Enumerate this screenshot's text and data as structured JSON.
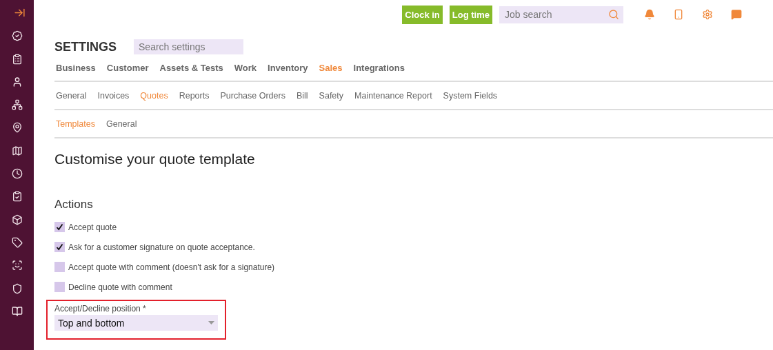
{
  "topbar": {
    "buttons": [
      {
        "label": "Clock in"
      },
      {
        "label": "Log time"
      }
    ],
    "search": {
      "placeholder": "Job search"
    }
  },
  "settings": {
    "title": "SETTINGS",
    "search": {
      "placeholder": "Search settings"
    }
  },
  "main_tabs": [
    {
      "label": "Business",
      "selected": false
    },
    {
      "label": "Customer",
      "selected": false
    },
    {
      "label": "Assets & Tests",
      "selected": false
    },
    {
      "label": "Work",
      "selected": false
    },
    {
      "label": "Inventory",
      "selected": false
    },
    {
      "label": "Sales",
      "selected": true
    },
    {
      "label": "Integrations",
      "selected": false
    }
  ],
  "sub_tabs": [
    {
      "label": "General",
      "selected": false
    },
    {
      "label": "Invoices",
      "selected": false
    },
    {
      "label": "Quotes",
      "selected": true
    },
    {
      "label": "Reports",
      "selected": false
    },
    {
      "label": "Purchase Orders",
      "selected": false
    },
    {
      "label": "Bill",
      "selected": false
    },
    {
      "label": "Safety",
      "selected": false
    },
    {
      "label": "Maintenance Report",
      "selected": false
    },
    {
      "label": "System Fields",
      "selected": false
    }
  ],
  "section_tabs": [
    {
      "label": "Templates",
      "selected": true
    },
    {
      "label": "General",
      "selected": false
    }
  ],
  "page_title": "Customise your quote template",
  "actions": {
    "heading": "Actions",
    "options": [
      {
        "label": "Accept quote",
        "checked": true
      },
      {
        "label": "Ask for a customer signature on quote acceptance.",
        "checked": true
      },
      {
        "label": "Accept quote with comment (doesn't ask for a signature)",
        "checked": false
      },
      {
        "label": "Decline quote with comment",
        "checked": false
      }
    ]
  },
  "position_field": {
    "label": "Accept/Decline position *",
    "value": "Top and bottom",
    "highlighted": true
  }
}
